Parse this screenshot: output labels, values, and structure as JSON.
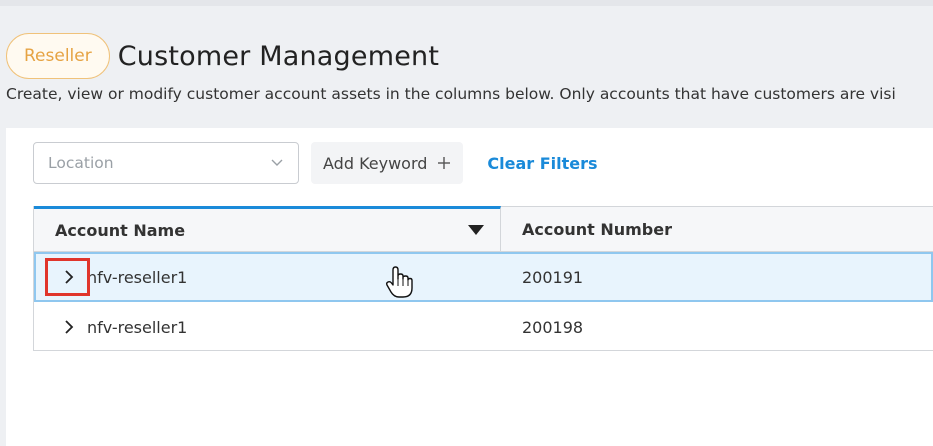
{
  "header": {
    "badge": "Reseller",
    "title": "Customer Management",
    "subtitle": "Create, view or modify customer account assets in the columns below. Only accounts that have customers are visi"
  },
  "filters": {
    "location_placeholder": "Location",
    "add_keyword_label": "Add Keyword",
    "clear_filters_label": "Clear Filters"
  },
  "table": {
    "columns": [
      "Account Name",
      "Account Number"
    ],
    "rows": [
      {
        "name": "nfv-reseller1",
        "number": "200191",
        "selected": true
      },
      {
        "name": "nfv-reseller1",
        "number": "200198",
        "selected": false
      }
    ]
  },
  "colors": {
    "accent": "#1a8ad9",
    "badge": "#e6a343",
    "highlight_box": "#e0352b"
  },
  "icons": [
    "chevron-down-icon",
    "plus-icon",
    "sort-caret-icon",
    "chevron-right-icon",
    "hand-cursor-icon"
  ]
}
